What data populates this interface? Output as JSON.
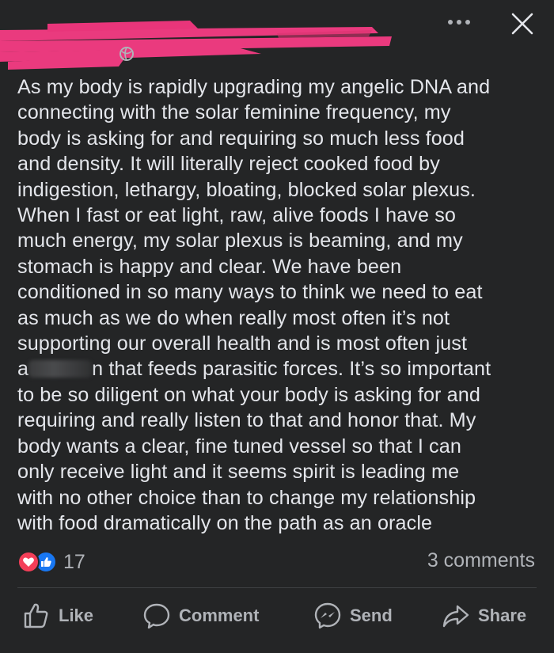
{
  "post": {
    "lines": [
      "As my body is rapidly upgrading my angelic DNA and",
      "connecting with the solar feminine frequency, my",
      "body is asking for and requiring so much less food",
      "and density. It will literally reject cooked food by",
      "indigestion, lethargy, bloating, blocked solar plexus.",
      "When I fast or eat light, raw, alive foods I have so",
      "much energy, my solar plexus is beaming, and my",
      "stomach is happy and clear. We have been",
      "conditioned in so many ways to think we need to eat",
      "as much as we do when really most often it’s not",
      "supporting our overall health and is most often just",
      "n that feeds parasitic forces. It’s so important",
      "to be so diligent on what your body is asking for and",
      "requiring and really listen to that and honor that. My",
      "body wants a clear, fine tuned vessel so that I can",
      "only receive light and it seems spirit is leading me",
      "with no other choice than to change my relationship",
      "with food dramatically on the path as an oracle"
    ],
    "line12_prefix": "a"
  },
  "reactions": {
    "count": "17",
    "types": [
      "love",
      "like"
    ],
    "colors": {
      "love": "#f33e58",
      "like": "#1877f2"
    }
  },
  "comments": {
    "count_label": "3 comments"
  },
  "actions": {
    "like_label": "Like",
    "comment_label": "Comment",
    "send_label": "Send",
    "share_label": "Share"
  },
  "header": {
    "icons": [
      "globe-icon",
      "more-options-icon",
      "close-icon"
    ],
    "redaction_color": "#ea3a7e"
  }
}
